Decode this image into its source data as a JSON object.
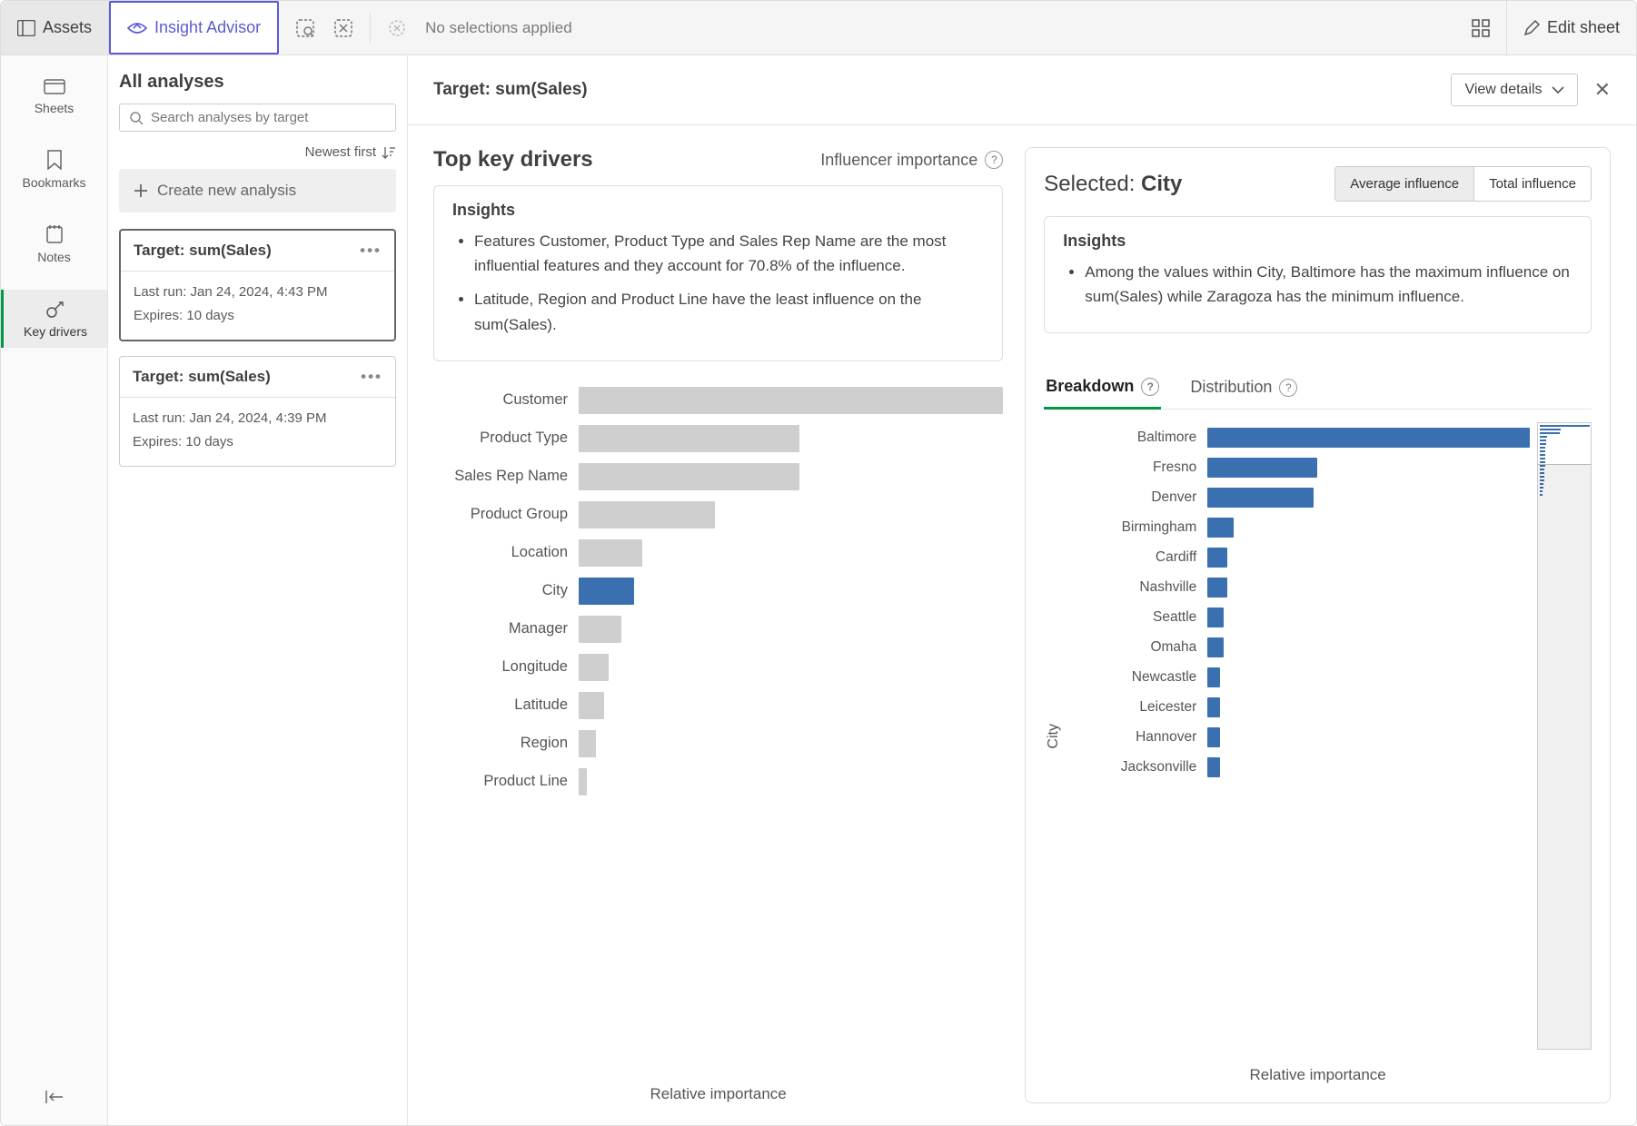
{
  "topbar": {
    "assets": "Assets",
    "advisor": "Insight Advisor",
    "no_sel": "No selections applied",
    "edit": "Edit sheet"
  },
  "rail": {
    "sheets": "Sheets",
    "bookmarks": "Bookmarks",
    "notes": "Notes",
    "keydrivers": "Key drivers"
  },
  "analyses": {
    "title": "All analyses",
    "search_ph": "Search analyses by target",
    "sort": "Newest first",
    "create": "Create new analysis",
    "cards": [
      {
        "title": "Target: sum(Sales)",
        "last": "Last run: Jan 24, 2024, 4:43 PM",
        "exp": "Expires: 10 days"
      },
      {
        "title": "Target: sum(Sales)",
        "last": "Last run: Jan 24, 2024, 4:39 PM",
        "exp": "Expires: 10 days"
      }
    ]
  },
  "contentHeader": {
    "target": "Target: sum(Sales)",
    "view": "View details"
  },
  "left": {
    "title": "Top key drivers",
    "sub": "Influencer importance",
    "insights_h": "Insights",
    "insights": [
      "Features Customer, Product Type and Sales Rep Name are the most influential features and they account for 70.8% of the influence.",
      "Latitude, Region and Product Line have the least influence on the sum(Sales)."
    ],
    "axis": "Relative importance"
  },
  "right": {
    "sel_prefix": "Selected: ",
    "sel_val": "City",
    "avg": "Average influence",
    "total": "Total influence",
    "insights_h": "Insights",
    "insights": [
      "Among the values within City, Baltimore has the maximum influence on sum(Sales) while Zaragoza has the minimum influence."
    ],
    "tab_breakdown": "Breakdown",
    "tab_dist": "Distribution",
    "axis_y": "City",
    "axis_x": "Relative importance"
  },
  "chart_data": [
    {
      "type": "bar",
      "title": "Top key drivers",
      "orientation": "horizontal",
      "xlabel": "Relative importance",
      "categories": [
        "Customer",
        "Product Type",
        "Sales Rep Name",
        "Product Group",
        "Location",
        "City",
        "Manager",
        "Longitude",
        "Latitude",
        "Region",
        "Product Line"
      ],
      "values": [
        100,
        52,
        52,
        32,
        15,
        13,
        10,
        7,
        6,
        4,
        2
      ],
      "highlight_index": 5,
      "xlim": [
        0,
        100
      ]
    },
    {
      "type": "bar",
      "title": "Breakdown — City",
      "orientation": "horizontal",
      "ylabel": "City",
      "xlabel": "Relative importance",
      "categories": [
        "Baltimore",
        "Fresno",
        "Denver",
        "Birmingham",
        "Cardiff",
        "Nashville",
        "Seattle",
        "Omaha",
        "Newcastle",
        "Leicester",
        "Hannover",
        "Jacksonville"
      ],
      "values": [
        100,
        34,
        33,
        8,
        6,
        6,
        5,
        5,
        4,
        4,
        4,
        4
      ],
      "xlim": [
        0,
        100
      ]
    }
  ]
}
